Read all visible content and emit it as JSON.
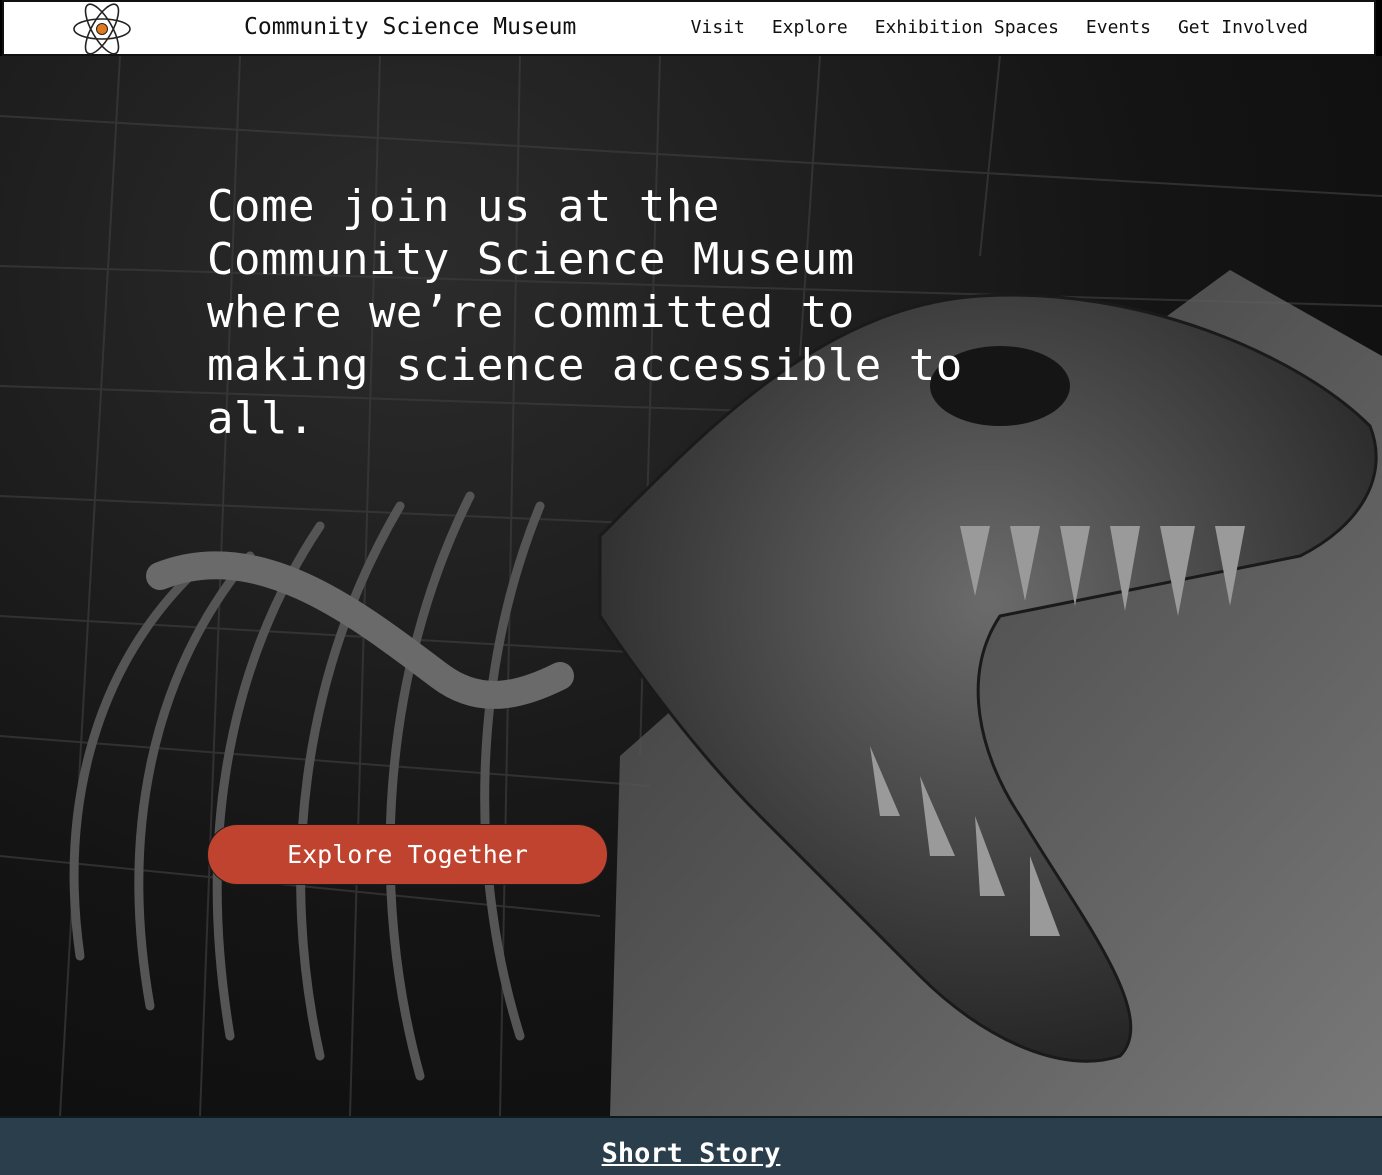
{
  "header": {
    "logo": "atom-logo-icon",
    "title": "Community Science Museum",
    "nav": [
      {
        "label": "Visit"
      },
      {
        "label": "Explore"
      },
      {
        "label": "Exhibition Spaces"
      },
      {
        "label": "Events"
      },
      {
        "label": "Get Involved"
      }
    ]
  },
  "hero": {
    "image": "dinosaur-skeleton-photo",
    "tagline": "Come join us at the Community Science Museum where we’re committed to making science accessible to all.",
    "cta_label": "Explore Together"
  },
  "section": {
    "title": "Short Story"
  },
  "colors": {
    "accent": "#c0432f",
    "section_bg": "#2a3e4b",
    "nav_bg": "#ffffff",
    "logo_nucleus": "#e07a1f"
  }
}
